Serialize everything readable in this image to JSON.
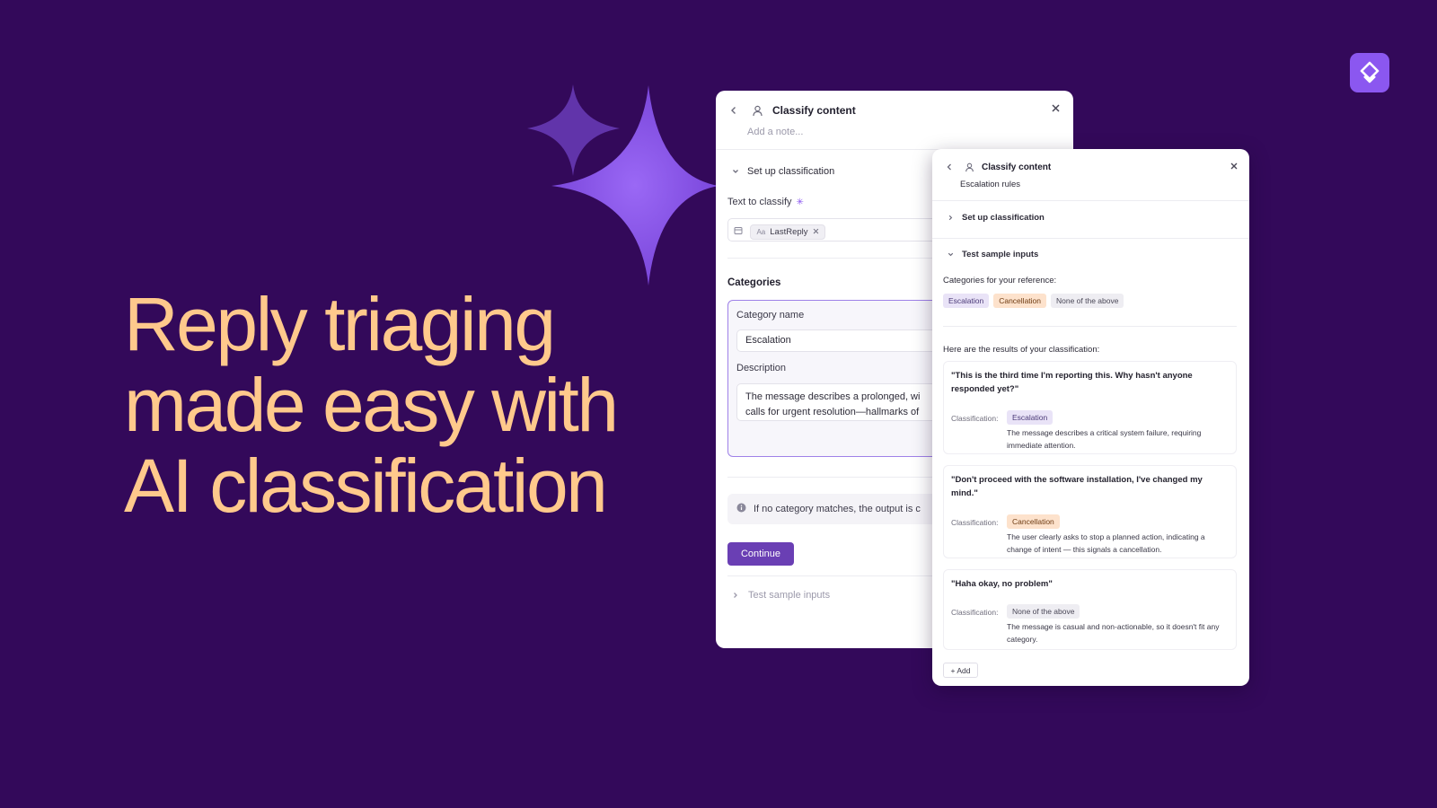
{
  "headline": {
    "line1": "Reply triaging",
    "line2": "made easy with",
    "line3": "AI classification"
  },
  "colors": {
    "background": "#33095a",
    "headline": "#ffc98c",
    "accent": "#6a3fb4",
    "sparkle": "#8a56ec",
    "logo": "#8b57f0"
  },
  "back_panel": {
    "title": "Classify content",
    "note_placeholder": "Add a note...",
    "setup_section": "Set up classification",
    "text_to_classify_label": "Text to classify",
    "chip_type": "Aa",
    "chip_label": "LastReply",
    "categories_heading": "Categories",
    "category_name_label": "Category name",
    "category_name_value": "Escalation",
    "description_label": "Description",
    "description_line1": "The message describes a prolonged, wi",
    "description_line2": "calls for urgent resolution—hallmarks of",
    "info_text": "If no category matches, the output is c",
    "continue_button": "Continue",
    "test_section": "Test sample inputs"
  },
  "front_panel": {
    "title": "Classify content",
    "subtitle": "Escalation rules",
    "setup_section": "Set up classification",
    "test_section": "Test sample inputs",
    "reference_label": "Categories for your reference:",
    "reference_tags": [
      "Escalation",
      "Cancellation",
      "None of the above"
    ],
    "results_label": "Here are the results of your classification:",
    "classification_label": "Classification:",
    "results": [
      {
        "quote": "\"This is the third time I'm reporting this. Why hasn't anyone responded yet?\"",
        "category": "Escalation",
        "reason": "The message describes a critical system failure, requiring immediate attention."
      },
      {
        "quote": "\"Don't proceed with the software installation, I've changed my mind.\"",
        "category": "Cancellation",
        "reason": "The user clearly asks to stop a planned action, indicating a change of intent — this signals a cancellation."
      },
      {
        "quote": "\"Haha okay, no problem\"",
        "category": "None of the above",
        "reason": "The message is casual and non-actionable, so it doesn't fit any category."
      }
    ],
    "add_button": "+ Add"
  }
}
